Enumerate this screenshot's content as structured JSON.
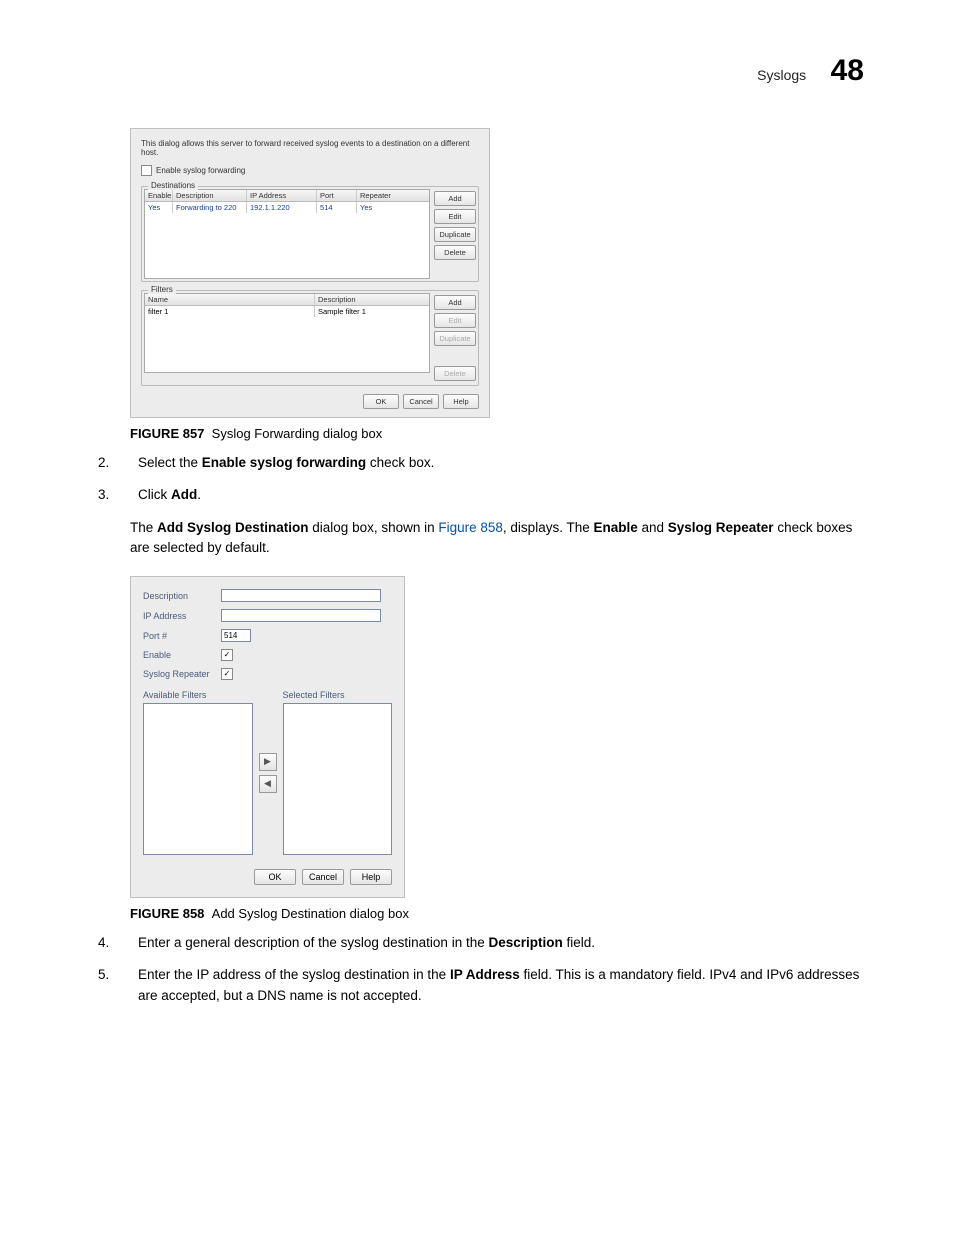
{
  "header": {
    "section": "Syslogs",
    "page_number": "48"
  },
  "figures": {
    "fig857": {
      "label": "FIGURE 857",
      "caption": "Syslog Forwarding dialog box"
    },
    "fig858": {
      "label": "FIGURE 858",
      "caption": "Add Syslog Destination dialog box"
    }
  },
  "steps": {
    "s2": {
      "num": "2.",
      "pre": "Select the ",
      "bold": "Enable syslog forwarding",
      "post": " check box."
    },
    "s3": {
      "num": "3.",
      "pre": "Click ",
      "bold": "Add",
      "post": "."
    },
    "s3_sub": {
      "t1": "The ",
      "b1": "Add Syslog Destination",
      "t2": " dialog box, shown in ",
      "link": "Figure 858",
      "t3": ", displays. The ",
      "b2": "Enable",
      "t4": " and ",
      "b3": "Syslog Repeater",
      "t5": " check boxes are selected by default."
    },
    "s4": {
      "num": "4.",
      "pre": "Enter a general description of the syslog destination in the ",
      "bold": "Description",
      "post": " field."
    },
    "s5": {
      "num": "5.",
      "pre": "Enter the IP address of the syslog destination in the ",
      "bold": "IP Address",
      "post": " field. This is a mandatory field. IPv4 and IPv6 addresses are accepted, but a DNS name is not accepted."
    }
  },
  "dlg1": {
    "intro": "This dialog allows this server to forward received syslog events to a destination on a different host.",
    "enable_label": "Enable syslog forwarding",
    "destinations": {
      "title": "Destinations",
      "cols": {
        "enable": "Enable",
        "desc": "Description",
        "ip": "IP Address",
        "port": "Port",
        "rep": "Repeater"
      },
      "row": {
        "enable": "Yes",
        "desc": "Forwarding to 220",
        "ip": "192.1.1.220",
        "port": "514",
        "rep": "Yes"
      },
      "btns": {
        "add": "Add",
        "edit": "Edit",
        "dup": "Duplicate",
        "del": "Delete"
      }
    },
    "filters": {
      "title": "Filters",
      "cols": {
        "name": "Name",
        "desc": "Description"
      },
      "row": {
        "name": "filter 1",
        "desc": "Sample filter 1"
      },
      "btns": {
        "add": "Add",
        "edit": "Edit",
        "dup": "Duplicate",
        "del": "Delete"
      }
    },
    "footer": {
      "ok": "OK",
      "cancel": "Cancel",
      "help": "Help"
    }
  },
  "dlg2": {
    "labels": {
      "desc": "Description",
      "ip": "IP Address",
      "port": "Port #",
      "enable": "Enable",
      "repeater": "Syslog Repeater",
      "avail": "Available Filters",
      "sel": "Selected Filters"
    },
    "values": {
      "port": "514"
    },
    "footer": {
      "ok": "OK",
      "cancel": "Cancel",
      "help": "Help"
    }
  }
}
